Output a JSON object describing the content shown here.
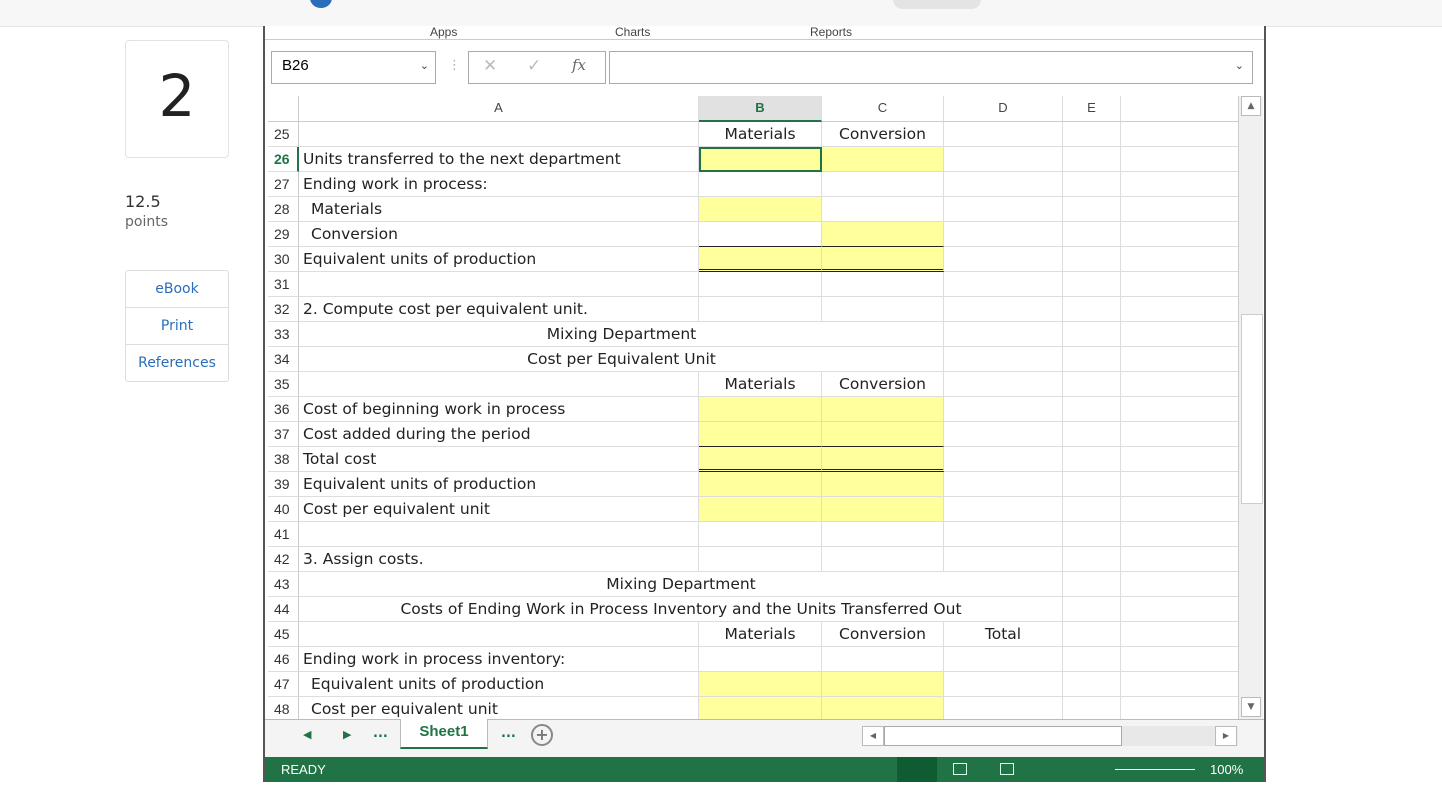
{
  "question": {
    "number": "2",
    "points": "12.5",
    "points_label": "points"
  },
  "tools": [
    "eBook",
    "Print",
    "References"
  ],
  "ribbon": {
    "groups": [
      "Apps",
      "Charts",
      "Reports"
    ]
  },
  "formula_bar": {
    "name_box": "B26",
    "formula": ""
  },
  "columns": [
    "A",
    "B",
    "C",
    "D",
    "E"
  ],
  "selected_cell": "B26",
  "rows": [
    {
      "n": "25",
      "a": "",
      "b": "Materials",
      "c": "Conversion"
    },
    {
      "n": "26",
      "a": "Units transferred to the next department"
    },
    {
      "n": "27",
      "a": "Ending work in process:"
    },
    {
      "n": "28",
      "a": "Materials",
      "indent": true
    },
    {
      "n": "29",
      "a": "Conversion",
      "indent": true
    },
    {
      "n": "30",
      "a": "Equivalent units of production"
    },
    {
      "n": "31",
      "a": ""
    },
    {
      "n": "32",
      "a": "2. Compute cost per equivalent unit."
    },
    {
      "n": "33",
      "center": "Mixing Department",
      "span": "AC"
    },
    {
      "n": "34",
      "center": "Cost per Equivalent Unit",
      "span": "AC"
    },
    {
      "n": "35",
      "a": "",
      "b": "Materials",
      "c": "Conversion"
    },
    {
      "n": "36",
      "a": "Cost of beginning work in process"
    },
    {
      "n": "37",
      "a": "Cost added during the period"
    },
    {
      "n": "38",
      "a": "Total cost"
    },
    {
      "n": "39",
      "a": "Equivalent units of production"
    },
    {
      "n": "40",
      "a": "Cost per equivalent unit"
    },
    {
      "n": "41",
      "a": ""
    },
    {
      "n": "42",
      "a": "3. Assign costs."
    },
    {
      "n": "43",
      "center": "Mixing Department",
      "span": "AD"
    },
    {
      "n": "44",
      "center": "Costs of Ending Work in Process Inventory and the Units Transferred Out",
      "span": "AD"
    },
    {
      "n": "45",
      "a": "",
      "b": "Materials",
      "c": "Conversion",
      "d": "Total"
    },
    {
      "n": "46",
      "a": "Ending work in process inventory:"
    },
    {
      "n": "47",
      "a": "Equivalent units of production",
      "indent": true
    },
    {
      "n": "48",
      "a": "Cost per equivalent unit",
      "indent": true
    }
  ],
  "input_cells": [
    "B26",
    "C26",
    "B28",
    "C29",
    "B30",
    "C30",
    "B36",
    "C36",
    "B37",
    "C37",
    "B38",
    "C38",
    "B39",
    "C39",
    "B40",
    "C40",
    "B47",
    "C47",
    "B48",
    "C48"
  ],
  "sheet_tabs": {
    "active": "Sheet1",
    "more": "..."
  },
  "status": {
    "text": "READY",
    "zoom": "100%"
  },
  "colors": {
    "input_fill": "#ffff9c",
    "excel_green": "#217346",
    "link": "#2a6ebb"
  }
}
